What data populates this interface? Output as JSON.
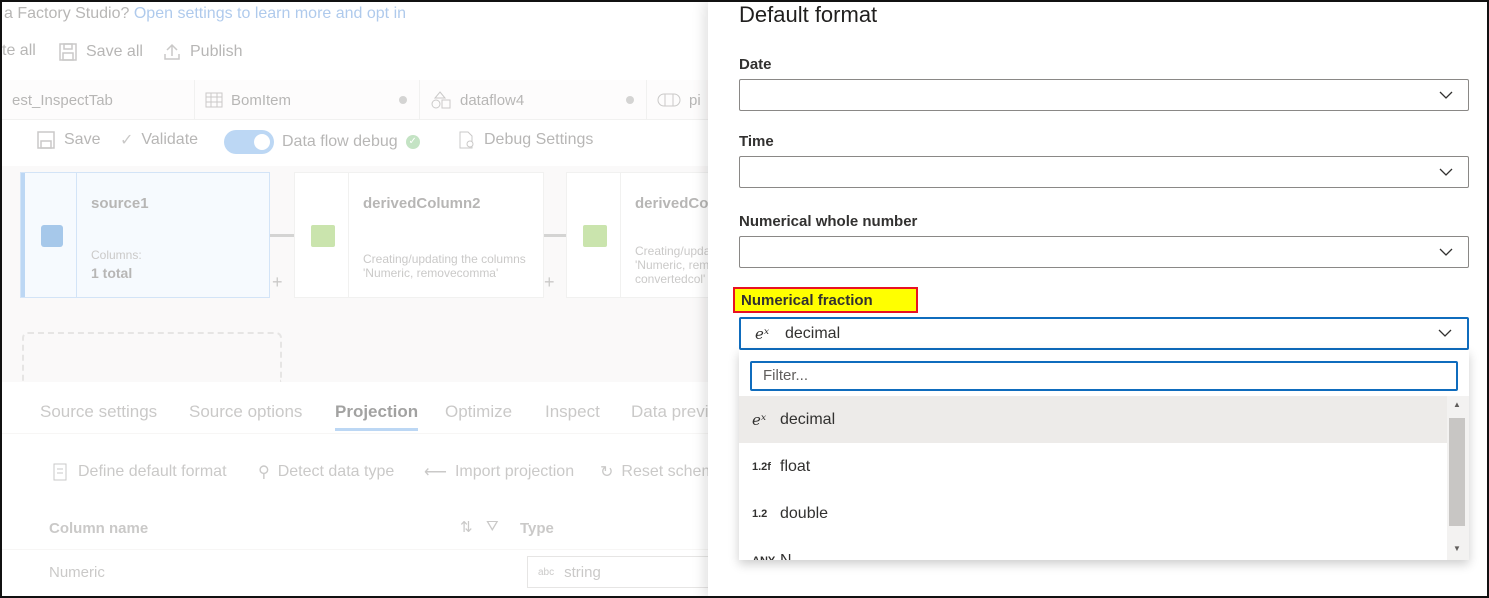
{
  "banner": {
    "text": "a Factory Studio?",
    "link": "Open settings to learn more and opt in"
  },
  "toolbar": {
    "validate_all": "te all",
    "save_all": "Save all",
    "publish": "Publish"
  },
  "tabs": [
    {
      "label": "est_InspectTab"
    },
    {
      "label": "BomItem"
    },
    {
      "label": "dataflow4"
    },
    {
      "label": "pi"
    }
  ],
  "dataflow_bar": {
    "save": "Save",
    "validate": "Validate",
    "debug": "Data flow debug",
    "debug_settings": "Debug Settings"
  },
  "nodes": [
    {
      "title": "source1",
      "sub1": "Columns:",
      "sub2": "1 total"
    },
    {
      "title": "derivedColumn2",
      "sub1": "Creating/updating the columns",
      "sub2": "'Numeric, removecomma'"
    },
    {
      "title": "derivedCol",
      "sub1": "Creating/upda",
      "sub2": "'Numeric, rem",
      "sub3": "convertedcol'"
    }
  ],
  "plus": "+",
  "props_tabs": [
    "Source settings",
    "Source options",
    "Projection",
    "Optimize",
    "Inspect",
    "Data previ"
  ],
  "actions": {
    "define": "Define default format",
    "detect": "Detect data type",
    "import": "Import projection",
    "reset": "Reset schem"
  },
  "grid": {
    "col_name": "Column name",
    "col_type": "Type",
    "row_name": "Numeric",
    "row_type_icon": "abc",
    "row_type": "string"
  },
  "panel": {
    "title": "Default format",
    "date_label": "Date",
    "time_label": "Time",
    "whole_label": "Numerical whole number",
    "fraction_label": "Numerical fraction",
    "fraction_value": "decimal",
    "fraction_icon": "eˣ",
    "filter_placeholder": "Filter...",
    "options": [
      {
        "icon": "eˣ",
        "label": "decimal"
      },
      {
        "icon": "1.2f",
        "label": "float"
      },
      {
        "icon": "1.2",
        "label": "double"
      },
      {
        "icon": "ANY",
        "label": "N"
      }
    ]
  },
  "colors": {
    "accent": "#0f6cbd",
    "highlight": "#ffff00",
    "highlight_border": "#e81123",
    "debug_on": "#6aa6e6",
    "check": "#7cc27c"
  }
}
